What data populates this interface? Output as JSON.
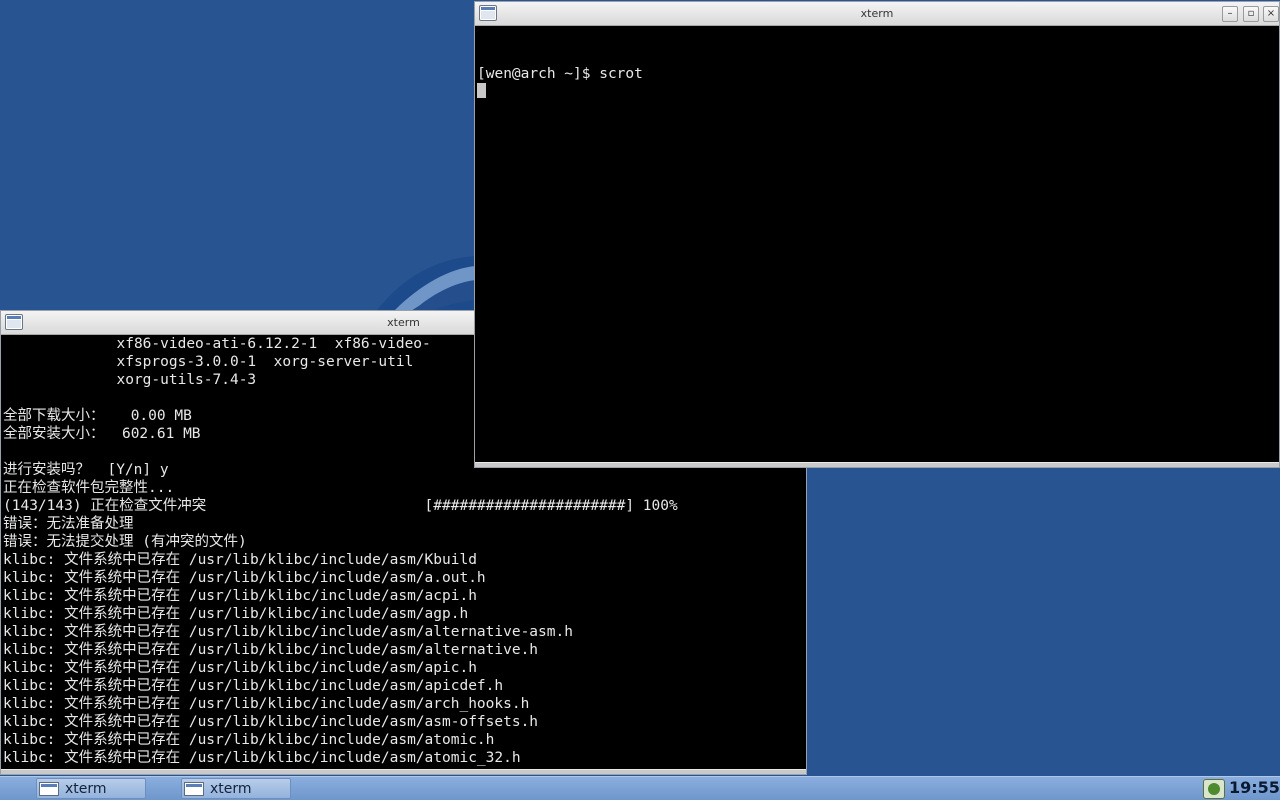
{
  "desktop": {
    "background_color": "#285592"
  },
  "window_front": {
    "title": "xterm",
    "lines": [
      "[wen@arch ~]$ scrot"
    ]
  },
  "window_back": {
    "title": "xterm",
    "lines": [
      "             xf86-video-ati-6.12.2-1  xf86-video-",
      "             xfsprogs-3.0.0-1  xorg-server-util",
      "             xorg-utils-7.4-3",
      "",
      "全部下载大小：   0.00 MB",
      "全部安装大小：  602.61 MB",
      "",
      "进行安装吗？  [Y/n] y",
      "正在检查软件包完整性...",
      "(143/143) 正在检查文件冲突                         [######################] 100%",
      "错误：无法准备处理",
      "错误：无法提交处理 (有冲突的文件)",
      "klibc: 文件系统中已存在 /usr/lib/klibc/include/asm/Kbuild",
      "klibc: 文件系统中已存在 /usr/lib/klibc/include/asm/a.out.h",
      "klibc: 文件系统中已存在 /usr/lib/klibc/include/asm/acpi.h",
      "klibc: 文件系统中已存在 /usr/lib/klibc/include/asm/agp.h",
      "klibc: 文件系统中已存在 /usr/lib/klibc/include/asm/alternative-asm.h",
      "klibc: 文件系统中已存在 /usr/lib/klibc/include/asm/alternative.h",
      "klibc: 文件系统中已存在 /usr/lib/klibc/include/asm/apic.h",
      "klibc: 文件系统中已存在 /usr/lib/klibc/include/asm/apicdef.h",
      "klibc: 文件系统中已存在 /usr/lib/klibc/include/asm/arch_hooks.h",
      "klibc: 文件系统中已存在 /usr/lib/klibc/include/asm/asm-offsets.h",
      "klibc: 文件系统中已存在 /usr/lib/klibc/include/asm/atomic.h",
      "klibc: 文件系统中已存在 /usr/lib/klibc/include/asm/atomic_32.h"
    ]
  },
  "taskbar": {
    "items": [
      {
        "label": "xterm",
        "icon": "terminal-icon"
      },
      {
        "label": "xterm",
        "icon": "terminal-icon"
      }
    ],
    "tray_icon": "network-status-icon",
    "clock": "19:55"
  }
}
